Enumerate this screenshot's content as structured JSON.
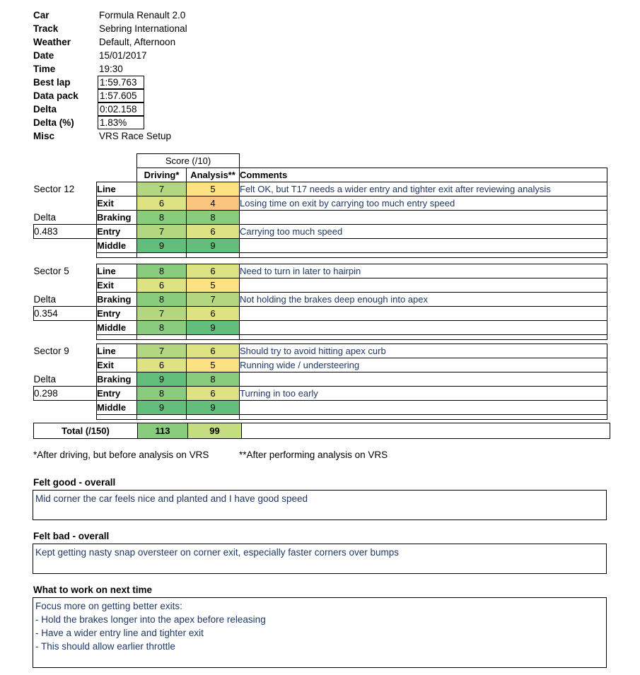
{
  "session": {
    "rows": [
      {
        "label": "Car",
        "value": "Formula Renault 2.0",
        "boxed": false
      },
      {
        "label": "Track",
        "value": "Sebring International",
        "boxed": false
      },
      {
        "label": "Weather",
        "value": "Default, Afternoon",
        "boxed": false
      },
      {
        "label": "Date",
        "value": "15/01/2017",
        "boxed": false
      },
      {
        "label": "Time",
        "value": "19:30",
        "boxed": false
      },
      {
        "label": "Best lap",
        "value": "1:59.763",
        "boxed": true
      },
      {
        "label": "Data pack",
        "value": "1:57.605",
        "boxed": true
      },
      {
        "label": "Delta",
        "value": "0:02.158",
        "boxed": true
      },
      {
        "label": "Delta (%)",
        "value": "1.83%",
        "boxed": true
      },
      {
        "label": "Misc",
        "value": "VRS Race Setup",
        "boxed": false
      }
    ]
  },
  "table_header": {
    "score_group": "Score (/10)",
    "driving": "Driving*",
    "analysis": "Analysis**",
    "comments": "Comments"
  },
  "labels": {
    "delta": "Delta"
  },
  "sectors": [
    {
      "name": "Sector 12",
      "delta": "0.483",
      "rows": [
        {
          "name": "Line",
          "driving": 7,
          "analysis": 5,
          "comment": "Felt OK, but T17 needs a wider entry and tighter exit after reviewing analysis"
        },
        {
          "name": "Exit",
          "driving": 6,
          "analysis": 4,
          "comment": "Losing time on exit by carrying too much entry speed"
        },
        {
          "name": "Braking",
          "driving": 8,
          "analysis": 8,
          "comment": ""
        },
        {
          "name": "Entry",
          "driving": 7,
          "analysis": 6,
          "comment": "Carrying too much speed"
        },
        {
          "name": "Middle",
          "driving": 9,
          "analysis": 9,
          "comment": ""
        }
      ]
    },
    {
      "name": "Sector 5",
      "delta": "0.354",
      "rows": [
        {
          "name": "Line",
          "driving": 8,
          "analysis": 6,
          "comment": "Need to turn in later to hairpin"
        },
        {
          "name": "Exit",
          "driving": 6,
          "analysis": 5,
          "comment": ""
        },
        {
          "name": "Braking",
          "driving": 8,
          "analysis": 7,
          "comment": "Not holding the brakes deep enough into apex"
        },
        {
          "name": "Entry",
          "driving": 7,
          "analysis": 6,
          "comment": ""
        },
        {
          "name": "Middle",
          "driving": 8,
          "analysis": 9,
          "comment": ""
        }
      ]
    },
    {
      "name": "Sector 9",
      "delta": "0.298",
      "rows": [
        {
          "name": "Line",
          "driving": 7,
          "analysis": 6,
          "comment": "Should try to avoid hitting apex curb"
        },
        {
          "name": "Exit",
          "driving": 6,
          "analysis": 5,
          "comment": "Running wide / understeering"
        },
        {
          "name": "Braking",
          "driving": 9,
          "analysis": 8,
          "comment": ""
        },
        {
          "name": "Entry",
          "driving": 8,
          "analysis": 6,
          "comment": "Turning in too early"
        },
        {
          "name": "Middle",
          "driving": 9,
          "analysis": 9,
          "comment": ""
        }
      ]
    }
  ],
  "total": {
    "label": "Total (/150)",
    "driving": "113",
    "analysis": "99",
    "driving_color": "#8ACC7E",
    "analysis_color": "#C5DD81"
  },
  "footnotes": {
    "driving": "*After driving, but before analysis on VRS",
    "analysis": "**After performing analysis on VRS"
  },
  "sections": [
    {
      "title": "Felt good - overall",
      "lines": [
        "Mid corner the car feels nice and planted and I have good speed"
      ]
    },
    {
      "title": "Felt bad - overall",
      "lines": [
        "Kept getting nasty snap oversteer on corner exit, especially faster corners over bumps"
      ]
    },
    {
      "title": "What to work on next time",
      "lines": [
        "Focus more on getting better exits:",
        "- Hold the brakes longer into the apex before releasing",
        "- Have a wider entry line and tighter exit",
        "- This should allow earlier throttle"
      ]
    }
  ],
  "score_colors": {
    "4": "#F8C47E",
    "5": "#FCE183",
    "6": "#DDE283",
    "7": "#B2D780",
    "8": "#8ACC7E",
    "9": "#63BE7B",
    "10": "#63BE7B"
  }
}
